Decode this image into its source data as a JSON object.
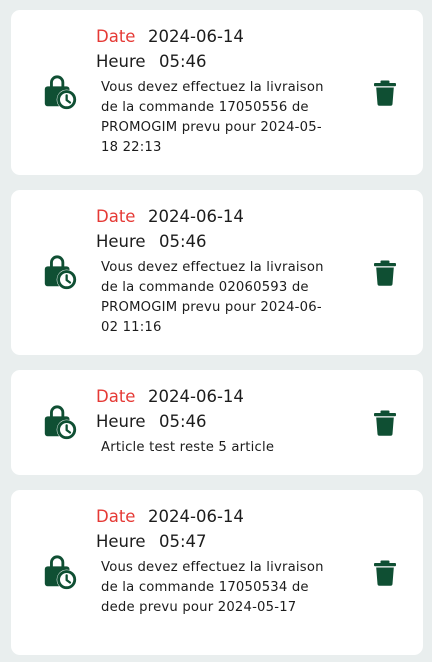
{
  "colors": {
    "background": "#e9eeee",
    "card": "#ffffff",
    "accent_green": "#0f4f33",
    "date_label": "#e53935"
  },
  "icons": {
    "main": "shopping-bag-clock-icon",
    "delete": "trash-icon"
  },
  "notifications": [
    {
      "date_label": "Date",
      "date": "2024-06-14",
      "time_label": "Heure",
      "time": "05:46",
      "message": "Vous devez effectuez la livraison de la commande 17050556 de PROMOGIM prevu pour 2024-05-18 22:13"
    },
    {
      "date_label": "Date",
      "date": "2024-06-14",
      "time_label": "Heure",
      "time": "05:46",
      "message": "Vous devez effectuez la livraison de la commande 02060593 de PROMOGIM prevu pour 2024-06-02 11:16"
    },
    {
      "date_label": "Date",
      "date": "2024-06-14",
      "time_label": "Heure",
      "time": "05:46",
      "message": "Article test reste 5 article"
    },
    {
      "date_label": "Date",
      "date": "2024-06-14",
      "time_label": "Heure",
      "time": "05:47",
      "message": "Vous devez effectuez la livraison de la commande 17050534 de dede prevu pour 2024-05-17"
    }
  ]
}
